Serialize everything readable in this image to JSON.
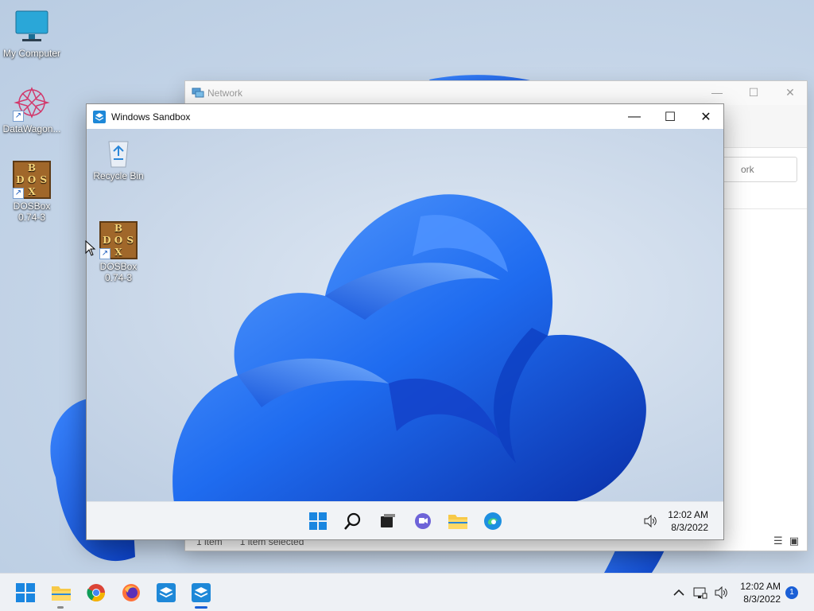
{
  "desktop": {
    "icons": [
      {
        "label": "My Computer",
        "icon": "monitor-icon"
      },
      {
        "label": "DataWagon...",
        "icon": "datawagon-icon"
      },
      {
        "label": "DOSBox\n0.74-3",
        "label_line1": "DOSBox",
        "label_line2": "0.74-3",
        "icon": "dosbox-icon"
      }
    ]
  },
  "network_window": {
    "title": "Network",
    "search_partial": "ork",
    "status_items": "1 item",
    "status_selected": "1 item selected"
  },
  "sandbox_window": {
    "title": "Windows Sandbox",
    "desktop_icons": [
      {
        "label": "Recycle Bin",
        "icon": "recycle-bin-icon"
      },
      {
        "label_line1": "DOSBox",
        "label_line2": "0.74-3",
        "icon": "dosbox-icon"
      }
    ],
    "taskbar": {
      "time": "12:02 AM",
      "date": "8/3/2022"
    }
  },
  "host_taskbar": {
    "time": "12:02 AM",
    "date": "8/3/2022",
    "notification_count": "1",
    "apps": [
      "start-icon",
      "file-explorer-icon",
      "chrome-icon",
      "firefox-icon",
      "sandbox-icon",
      "sandbox-icon"
    ]
  },
  "colors": {
    "accent": "#1a5fd6",
    "bloom": "#1f6cf0",
    "taskbar": "#eef1f5"
  }
}
